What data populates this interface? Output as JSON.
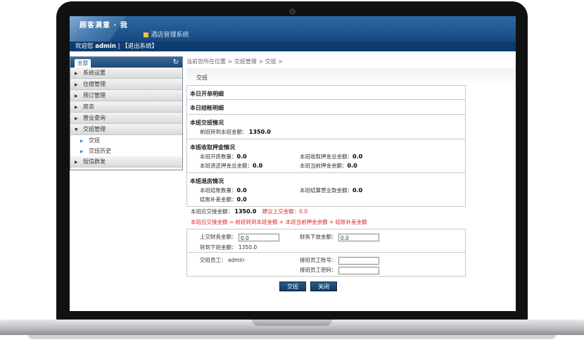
{
  "app": {
    "logo_text": "顾客满意 · 我",
    "title": "酒店管理系统"
  },
  "userbar": {
    "welcome_prefix": "欢迎您",
    "username": "admin",
    "separator": "|",
    "logout": "【退出系统】"
  },
  "sidebar": {
    "tab_label": "全部",
    "items": [
      {
        "label": "系统设置"
      },
      {
        "label": "住宿管理"
      },
      {
        "label": "预订管理"
      },
      {
        "label": "房态"
      },
      {
        "label": "营业查询"
      },
      {
        "label": "交班管理"
      },
      {
        "label": "短信群发"
      }
    ],
    "subitems": [
      {
        "label": "交班"
      },
      {
        "label": "交班历史"
      }
    ]
  },
  "breadcrumb": "当前您所在位置 > 交班管理 > 交班 >",
  "page_title": "交班",
  "sections": {
    "open_detail": "本日开单明细",
    "close_detail": "本日结帐明细",
    "shift_status": {
      "title": "本班交班情况",
      "prev_transfer_label": "前班转到本班金额：",
      "prev_transfer_value": "1350.0"
    },
    "deposit": {
      "title": "本班收取押金情况",
      "count_label": "本班开房数量：",
      "count_value": "0.0",
      "total_label": "本班收取押金总金额：",
      "total_value": "0.0",
      "refund_label": "本班退还押金总金额：",
      "refund_value": "0.0",
      "balance_label": "本班当前押金余额：",
      "balance_value": "0.0"
    },
    "checkout": {
      "title": "本班退房情况",
      "count_label": "本班结账数量：",
      "count_value": "0.0",
      "revenue_label": "本班结算营业款金额：",
      "revenue_value": "0.0",
      "supplement_label": "结账补差金额：",
      "supplement_value": "0.0"
    }
  },
  "handover": {
    "amount_label": "本班应交接金额：",
    "amount_value": "1350.0",
    "suggest_label": "建议上交金额：",
    "suggest_value": "0.0",
    "formula": "本班应交接金额 = 前班转到本班金额 + 本班当前押金余额 + 结账补差金额"
  },
  "finance": {
    "upload_label": "上交财务金额：",
    "upload_value": "0.0",
    "issue_label": "财务下放金额：",
    "issue_value": "0.0",
    "next_label": "转到下班金额：",
    "next_value": "1350.0"
  },
  "staff": {
    "shift_staff_label": "交班员工：",
    "shift_staff_value": "admin",
    "receiver_account_label": "接班员工账号：",
    "receiver_password_label": "接班员工密码："
  },
  "buttons": {
    "submit": "交班",
    "close": "关闭"
  }
}
